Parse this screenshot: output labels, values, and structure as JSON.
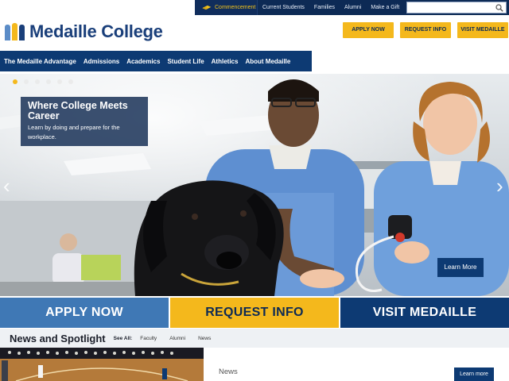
{
  "utility": {
    "commencement": "Commencement",
    "links": [
      "Current Students",
      "Families",
      "Alumni",
      "Make a Gift"
    ],
    "search_placeholder": ""
  },
  "brand": {
    "name": "Medaille College",
    "logo_colors": [
      "#5b8cc7",
      "#f4b81c",
      "#1a3f7a"
    ]
  },
  "header_ctas": [
    "APPLY NOW",
    "REQUEST INFO",
    "VISIT MEDAILLE"
  ],
  "main_nav": [
    "The Medaille Advantage",
    "Admissions",
    "Academics",
    "Student Life",
    "Athletics",
    "About Medaille"
  ],
  "hero": {
    "slide_count": 6,
    "active_slide": 1,
    "title": "Where College Meets Career",
    "subtitle": "Learn by doing and prepare for the workplace.",
    "learn_more": "Learn More",
    "prev_icon": "chevron-left-icon",
    "next_icon": "chevron-right-icon"
  },
  "cta_bars": [
    {
      "label": "APPLY NOW",
      "bg": "#3f78b5",
      "fg": "#ffffff"
    },
    {
      "label": "REQUEST INFO",
      "bg": "#f4b81c",
      "fg": "#0d2a55"
    },
    {
      "label": "VISIT MEDAILLE",
      "bg": "#0d3a73",
      "fg": "#ffffff"
    }
  ],
  "news": {
    "heading": "News and Spotlight",
    "see_all": "See All:",
    "filters": [
      "Faculty",
      "Alumni",
      "News"
    ],
    "section_label": "News",
    "learn_more": "Learn more"
  },
  "colors": {
    "navy": "#0d3a73",
    "gold": "#f4b81c",
    "blue": "#3f78b5"
  }
}
